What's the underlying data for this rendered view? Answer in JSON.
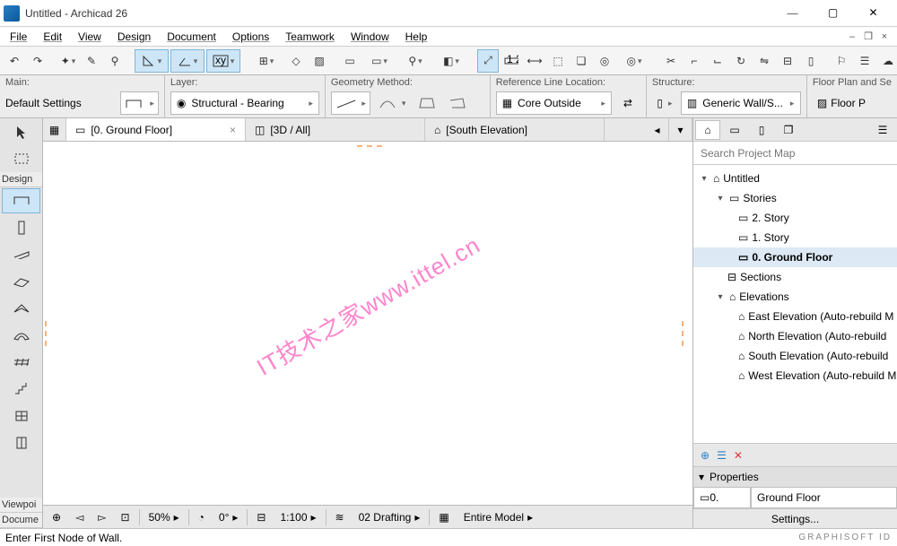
{
  "window": {
    "title": "Untitled - Archicad 26"
  },
  "menus": [
    "File",
    "Edit",
    "View",
    "Design",
    "Document",
    "Options",
    "Teamwork",
    "Window",
    "Help"
  ],
  "option_groups": {
    "main": {
      "label": "Main:",
      "value": "Default Settings"
    },
    "layer": {
      "label": "Layer:",
      "value": "Structural - Bearing"
    },
    "geometry": {
      "label": "Geometry Method:"
    },
    "refline": {
      "label": "Reference Line Location:",
      "value": "Core Outside"
    },
    "structure": {
      "label": "Structure:",
      "value": "Generic Wall/S..."
    },
    "floorplan": {
      "label": "Floor Plan and Se",
      "value": "Floor P"
    }
  },
  "view_tabs": {
    "ground": "[0. Ground Floor]",
    "three_d": "[3D / All]",
    "south": "[South Elevation]"
  },
  "left_sections": {
    "design": "Design",
    "viewpoi": "Viewpoi",
    "docume": "Docume"
  },
  "watermark": "IT技术之家www.ittel.cn",
  "bottom": {
    "zoom": "50%",
    "angle": "0°",
    "scale": "1:100",
    "layer_combo": "02 Drafting",
    "model": "Entire Model"
  },
  "navigator": {
    "search_placeholder": "Search Project Map",
    "root": "Untitled",
    "stories": "Stories",
    "story2": "2. Story",
    "story1": "1. Story",
    "ground": "0. Ground Floor",
    "sections": "Sections",
    "elevations": "Elevations",
    "east": "East Elevation (Auto-rebuild M",
    "north": "North Elevation (Auto-rebuild",
    "south": "South Elevation (Auto-rebuild",
    "west": "West Elevation (Auto-rebuild M"
  },
  "properties": {
    "header": "Properties",
    "code": "0.",
    "name": "Ground Floor",
    "settings": "Settings..."
  },
  "status_text": "Enter First Node of Wall.",
  "brand": "GRAPHISOFT ID"
}
